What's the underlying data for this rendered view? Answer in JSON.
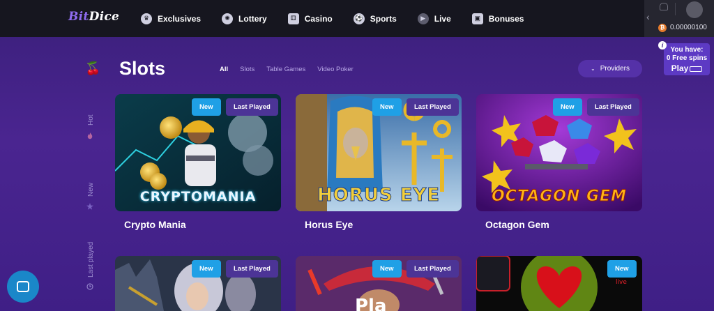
{
  "brand": {
    "part1": "Bit",
    "part2": "Dice"
  },
  "nav": [
    {
      "label": "Exclusives",
      "icon": "crown-icon"
    },
    {
      "label": "Lottery",
      "icon": "lottery-ball-icon"
    },
    {
      "label": "Casino",
      "icon": "dice-icon"
    },
    {
      "label": "Sports",
      "icon": "soccer-ball-icon"
    },
    {
      "label": "Live",
      "icon": "play-icon"
    },
    {
      "label": "Bonuses",
      "icon": "gift-icon"
    }
  ],
  "account": {
    "balance": "0.00000100",
    "currency_icon": "bitcoin-icon"
  },
  "free_spins": {
    "line1": "You have:",
    "line2": "0 Free spins",
    "play": "Play"
  },
  "page": {
    "title": "Slots"
  },
  "filters": [
    "All",
    "Slots",
    "Table Games",
    "Video Poker"
  ],
  "providers_label": "Providers",
  "sidebar": {
    "hot": "Hot",
    "new": "New",
    "last_played": "Last played"
  },
  "games": [
    {
      "title": "Crypto Mania",
      "logo": "CRYPTOMANIA",
      "new": "New",
      "last_played": "Last Played"
    },
    {
      "title": "Horus Eye",
      "logo": "HORUS EYE",
      "new": "New",
      "last_played": "Last Played"
    },
    {
      "title": "Octagon Gem",
      "logo": "OCTAGON GEM",
      "new": "New",
      "last_played": "Last Played"
    },
    {
      "title": "",
      "logo": "",
      "new": "New",
      "last_played": "Last Played"
    },
    {
      "title": "",
      "logo": "",
      "new": "New",
      "last_played": "Last Played"
    },
    {
      "title": "",
      "logo": "",
      "new": "New",
      "last_played": ""
    }
  ],
  "colors": {
    "accent": "#1fa0e6",
    "panel": "#16161f",
    "bg": "#3f1f86"
  }
}
